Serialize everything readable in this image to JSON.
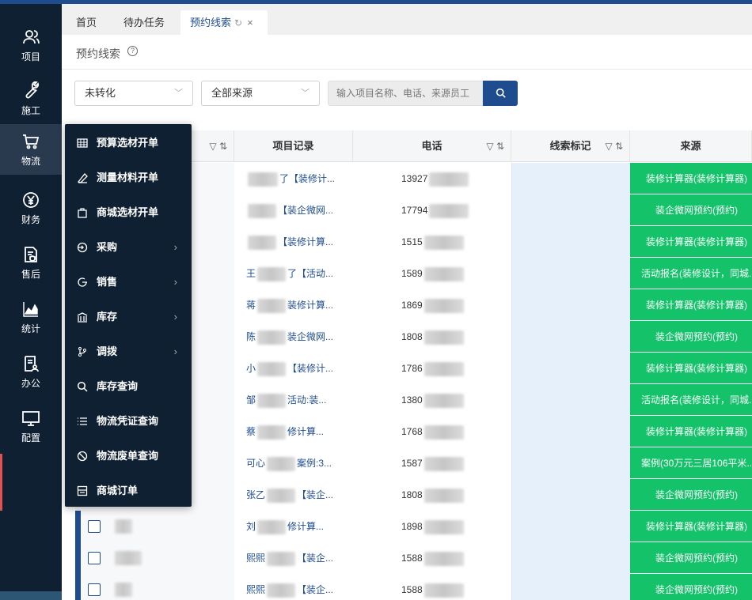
{
  "sidebar": {
    "items": [
      {
        "label": "项目",
        "icon": "user-group-icon"
      },
      {
        "label": "施工",
        "icon": "wrench-icon"
      },
      {
        "label": "物流",
        "icon": "cart-icon"
      },
      {
        "label": "财务",
        "icon": "yen-icon"
      },
      {
        "label": "售后",
        "icon": "doc-shield-icon"
      },
      {
        "label": "统计",
        "icon": "chart-icon"
      },
      {
        "label": "办公",
        "icon": "doc-person-icon"
      },
      {
        "label": "配置",
        "icon": "monitor-icon"
      }
    ],
    "active": "物流"
  },
  "tabs": [
    {
      "label": "首页"
    },
    {
      "label": "待办任务"
    },
    {
      "label": "预约线索",
      "active": true,
      "refresh": "↻",
      "close": "×"
    }
  ],
  "breadcrumb": {
    "title": "预约线索",
    "help": "?"
  },
  "filters": {
    "status": "未转化",
    "source": "全部来源",
    "search_placeholder": "输入项目名称、电话、来源员工"
  },
  "table": {
    "headers": {
      "record": "项目记录",
      "phone": "电话",
      "mark": "线索标记",
      "source": "来源"
    },
    "sort_icons": "▽ ⇅",
    "rows": [
      {
        "record": "了【装修计...",
        "phone": "13927",
        "source": "装修计算器(装修计算器)"
      },
      {
        "record": "【装企微网...",
        "phone": "17794",
        "source": "装企微网预约(预约)"
      },
      {
        "record": "【装修计算...",
        "phone": "1515",
        "source": "装修计算器(装修计算器)"
      },
      {
        "record": "了【活动...",
        "phone": "1589",
        "source": "活动报名(装修设计，同城..."
      },
      {
        "record": "装修计算...",
        "phone": "1869",
        "source": "装修计算器(装修计算器)"
      },
      {
        "record": "装企微网...",
        "phone": "1808",
        "source": "装企微网预约(预约)"
      },
      {
        "record": "【装修计...",
        "phone": "1786",
        "source": "装修计算器(装修计算器)"
      },
      {
        "record": "活动:装...",
        "phone": "1380",
        "source": "活动报名(装修设计，同城..."
      },
      {
        "record": "修计算...",
        "phone": "1768",
        "source": "装修计算器(装修计算器)"
      },
      {
        "record": "案例:3...",
        "phone": "1587",
        "source": "案例(30万元三居106平米..."
      },
      {
        "record": "【装企...",
        "phone": "1808",
        "source": "装企微网预约(预约)"
      },
      {
        "record": "修计算...",
        "phone": "1898",
        "source": "装修计算器(装修计算器)"
      },
      {
        "record": "【装企...",
        "phone": "1588",
        "source": "装企微网预约(预约)"
      },
      {
        "record": "【装企...",
        "phone": "1588",
        "source": "装企微网预约(预约)"
      }
    ],
    "row_prefixes": [
      "",
      "",
      "",
      "王",
      "蒋",
      "陈",
      "小",
      "邹",
      "蔡",
      "可心",
      "张乙",
      "刘",
      "熙熙",
      "熙熙"
    ]
  },
  "dropdown": {
    "items": [
      {
        "label": "预算选材开单",
        "icon": "table-icon"
      },
      {
        "label": "测量材料开单",
        "icon": "ruler-icon"
      },
      {
        "label": "商城选材开单",
        "icon": "bag-icon"
      },
      {
        "label": "采购",
        "icon": "purchase-icon",
        "arrow": "›"
      },
      {
        "label": "销售",
        "icon": "sales-icon",
        "arrow": "›"
      },
      {
        "label": "库存",
        "icon": "warehouse-icon",
        "arrow": "›"
      },
      {
        "label": "调拨",
        "icon": "transfer-icon",
        "arrow": "›"
      },
      {
        "label": "库存查询",
        "icon": "search-icon"
      },
      {
        "label": "物流凭证查询",
        "icon": "list-icon"
      },
      {
        "label": "物流废单查询",
        "icon": "ban-icon"
      },
      {
        "label": "商城订单",
        "icon": "order-icon"
      }
    ]
  }
}
